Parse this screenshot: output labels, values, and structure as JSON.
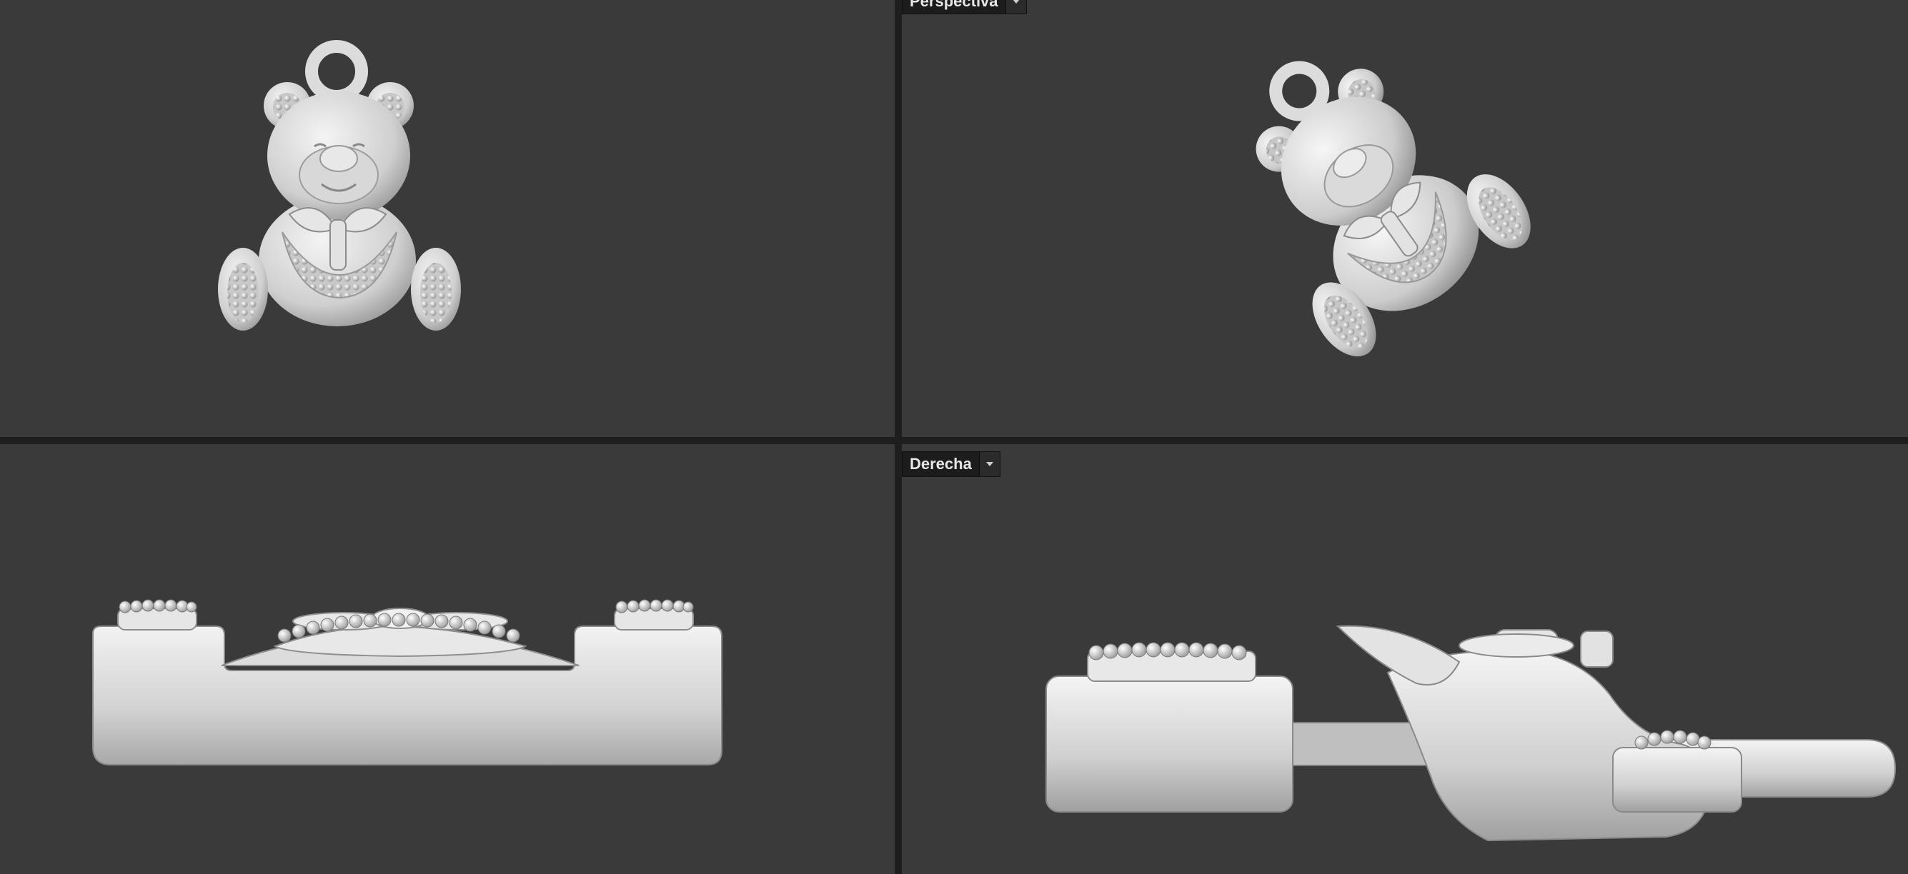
{
  "viewports": {
    "perspective": {
      "label": "Perspectiva"
    },
    "right": {
      "label": "Derecha"
    }
  },
  "icons": {
    "viewport_menu": "chevron-down-icon"
  },
  "colors": {
    "viewport_background": "#3a3a3a",
    "divider": "#1e1e1e",
    "label_background": "#1c1c1c",
    "label_text": "#e6e6e6",
    "model": "#d9d9d9"
  }
}
